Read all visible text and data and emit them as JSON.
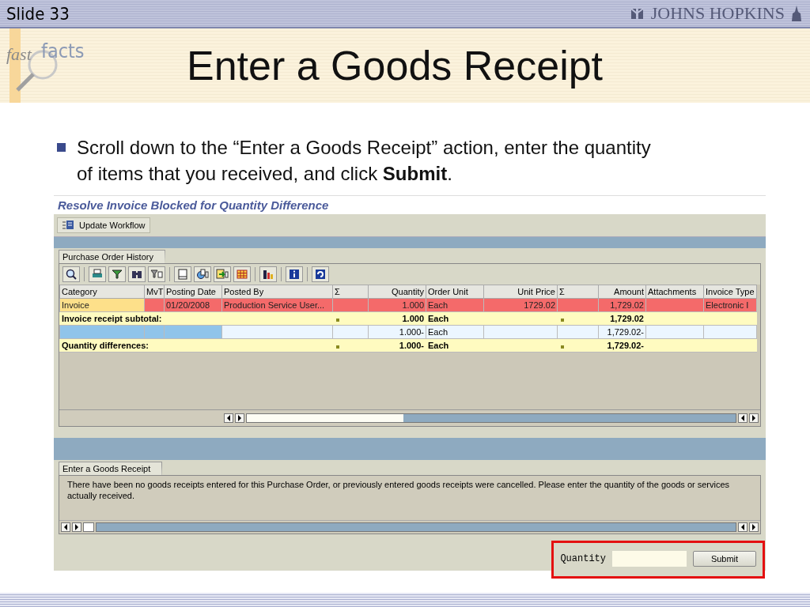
{
  "slide": {
    "number": "Slide 33",
    "brand": "JOHNS HOPKINS",
    "logo": {
      "word_1": "fast",
      "word_2": "facts"
    },
    "title": "Enter a Goods Receipt",
    "bullet": "Scroll down to the “Enter a Goods Receipt” action, enter the quantity of items that you received, and click **Submit**."
  },
  "screen": {
    "heading": "Resolve Invoice Blocked for Quantity Difference",
    "toolbar_button": "Update Workflow",
    "history": {
      "tab": "Purchase Order History",
      "columns": [
        "Category",
        "MvT",
        "Posting Date",
        "Posted By",
        "Σ",
        "Quantity",
        "Order Unit",
        "Unit Price",
        "Σ",
        "Amount",
        "Attachments",
        "Invoice Type"
      ],
      "rows": [
        {
          "kind": "invoice",
          "category": "Invoice",
          "posting_date": "01/20/2008",
          "posted_by": "Production Service User...",
          "quantity": "1.000",
          "order_unit": "Each",
          "unit_price": "1729.02",
          "amount": "1,729.02",
          "invoice_type": "Electronic I"
        },
        {
          "kind": "subtotal",
          "label": "Invoice receipt subtotal:",
          "quantity": "1.000",
          "order_unit": "Each",
          "amount": "1,729.02"
        },
        {
          "kind": "receipt",
          "quantity": "1.000-",
          "order_unit": "Each",
          "amount": "1,729.02-"
        },
        {
          "kind": "subtotal",
          "label": "Quantity differences:",
          "quantity": "1.000-",
          "order_unit": "Each",
          "amount": "1,729.02-"
        }
      ]
    },
    "goods_receipt": {
      "tab": "Enter a Goods Receipt",
      "message": "There have been no goods receipts entered for this Purchase Order, or previously entered goods receipts were cancelled. Please enter the quantity of the goods or services actually received.",
      "quantity_label": "Quantity",
      "submit": "Submit"
    }
  }
}
